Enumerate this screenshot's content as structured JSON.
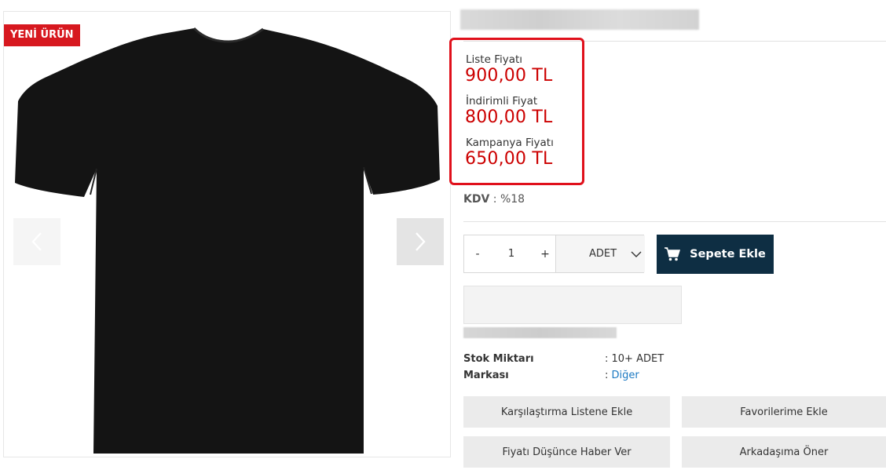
{
  "gallery": {
    "badge": "YENİ ÜRÜN",
    "prev_icon": "chevron-left-icon",
    "next_icon": "chevron-right-icon"
  },
  "prices": {
    "list_label": "Liste Fiyatı",
    "list_value": "900,00 TL",
    "discount_label": "İndirimli Fiyat",
    "discount_value": "800,00 TL",
    "campaign_label": "Kampanya Fiyatı",
    "campaign_value": "650,00 TL",
    "highlight_color": "#e0101b",
    "price_color": "#cc0000"
  },
  "tax": {
    "label": "KDV",
    "separator": " : ",
    "value": "%18"
  },
  "quantity": {
    "minus": "-",
    "value": "1",
    "plus": "+",
    "unit": "ADET"
  },
  "cart": {
    "label": "Sepete Ekle",
    "icon": "cart-icon",
    "color": "#0e2e43"
  },
  "info": {
    "stock_label": "Stok Miktarı",
    "stock_value": ": 10+ ADET",
    "brand_label": "Markası",
    "brand_prefix": ": ",
    "brand_value": "Diğer"
  },
  "actions": {
    "compare": "Karşılaştırma Listene Ekle",
    "favorites": "Favorilerime Ekle",
    "price_alert": "Fiyatı Düşünce Haber Ver",
    "recommend": "Arkadaşıma Öner"
  }
}
